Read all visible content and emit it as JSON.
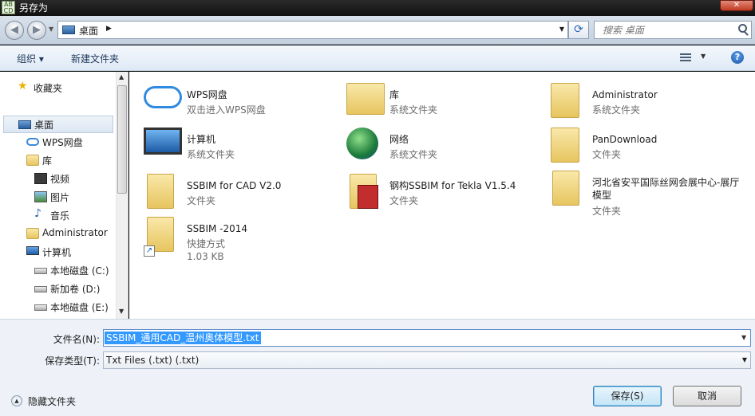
{
  "window": {
    "title": "另存为",
    "close_label": "✕"
  },
  "address": {
    "crumb": "桌面",
    "search_placeholder": "搜索 桌面"
  },
  "toolbar": {
    "organize": "组织 ▾",
    "new_folder": "新建文件夹"
  },
  "nav": {
    "items": [
      {
        "label": "收藏夹",
        "icon": "star-icon"
      },
      {
        "label": "桌面",
        "icon": "desktop-icon",
        "selected": true
      },
      {
        "label": "WPS网盘",
        "icon": "cloud-icon"
      },
      {
        "label": "库",
        "icon": "library-icon"
      },
      {
        "label": "视频",
        "icon": "video-icon"
      },
      {
        "label": "图片",
        "icon": "picture-icon"
      },
      {
        "label": "音乐",
        "icon": "music-icon"
      },
      {
        "label": "Administrator",
        "icon": "user-folder-icon"
      },
      {
        "label": "计算机",
        "icon": "computer-icon"
      },
      {
        "label": "本地磁盘 (C:)",
        "icon": "drive-icon"
      },
      {
        "label": "新加卷 (D:)",
        "icon": "drive-icon"
      },
      {
        "label": "本地磁盘 (E:)",
        "icon": "drive-icon"
      }
    ]
  },
  "files": [
    {
      "name": "WPS网盘",
      "sub": "双击进入WPS网盘",
      "icon": "cloud-icon"
    },
    {
      "name": "库",
      "sub": "系统文件夹",
      "icon": "library-icon"
    },
    {
      "name": "Administrator",
      "sub": "系统文件夹",
      "icon": "user-folder-icon"
    },
    {
      "name": "计算机",
      "sub": "系统文件夹",
      "icon": "computer-icon"
    },
    {
      "name": "网络",
      "sub": "系统文件夹",
      "icon": "network-icon"
    },
    {
      "name": "PanDownload",
      "sub": "文件夹",
      "icon": "folder-icon"
    },
    {
      "name": "SSBIM for CAD V2.0",
      "sub": "文件夹",
      "icon": "folder-icon"
    },
    {
      "name": "钢构SSBIM for Tekla V1.5.4",
      "sub": "文件夹",
      "icon": "app-folder-icon"
    },
    {
      "name": "河北省安平国际丝网会展中心-展厅模型",
      "sub": "文件夹",
      "icon": "folder-icon"
    },
    {
      "name": "SSBIM -2014",
      "sub": "快捷方式",
      "sub2": "1.03 KB",
      "icon": "shortcut-icon"
    }
  ],
  "form": {
    "filename_label": "文件名(N):",
    "filename_value": "SSBIM_通用CAD_温州奥体模型.txt",
    "filetype_label": "保存类型(T):",
    "filetype_value": "Txt Files (.txt) (.txt)"
  },
  "footer": {
    "hide_folders": "隐藏文件夹",
    "save": "保存(S)",
    "cancel": "取消"
  }
}
